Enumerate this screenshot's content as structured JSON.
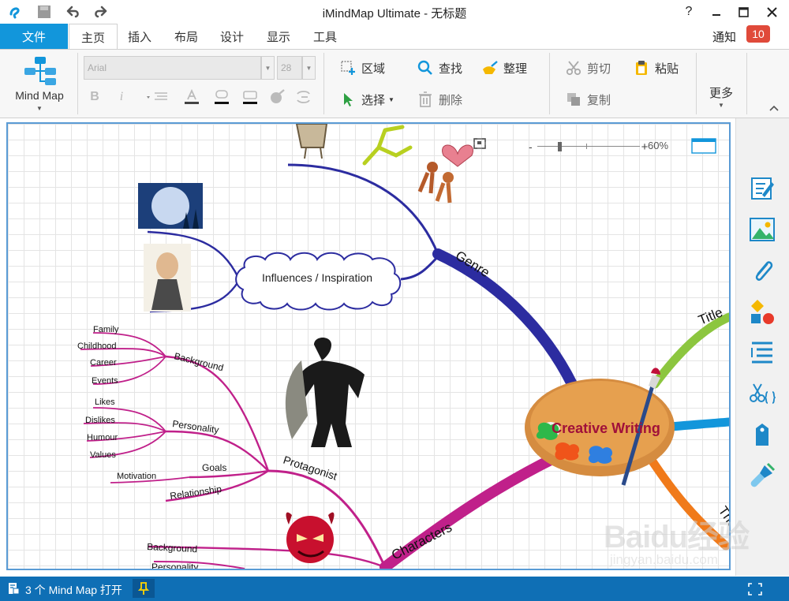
{
  "window": {
    "title": "iMindMap Ultimate - 无标题"
  },
  "quick_access": {
    "help": "?"
  },
  "tabs": {
    "file": "文件",
    "home": "主页",
    "insert": "插入",
    "layout": "布局",
    "design": "设计",
    "view": "显示",
    "tools": "工具"
  },
  "notification": {
    "label": "通知",
    "count": "10"
  },
  "ribbon": {
    "mindmap_label": "Mind Map",
    "font_name": "Arial",
    "font_size": "28",
    "area": "区域",
    "find": "查找",
    "tidy": "整理",
    "cut": "剪切",
    "paste": "粘贴",
    "select": "选择",
    "delete": "删除",
    "copy": "复制",
    "more": "更多"
  },
  "zoom": {
    "level": "60%"
  },
  "mindmap": {
    "central": "Creative Writing",
    "branches": {
      "genre": "Genre",
      "characters": "Characters",
      "title": "Title",
      "theme": "The"
    },
    "influences": "Influences / Inspiration",
    "protagonist": "Protagonist",
    "background": "Background",
    "personality": "Personality",
    "goals": "Goals",
    "relationship": "Relationship",
    "family": "Family",
    "childhood": "Childhood",
    "career": "Career",
    "events": "Events",
    "likes": "Likes",
    "dislikes": "Dislikes",
    "humour": "Humour",
    "values": "Values",
    "motivation": "Motivation",
    "villain_background": "Background",
    "villain_personality": "Personality"
  },
  "status": {
    "text": "3 个 Mind Map 打开"
  },
  "watermark": {
    "logo": "Baidu经验",
    "url": "jingyan.baidu.com"
  },
  "colors": {
    "accent": "#1296db",
    "status_bar": "#0f6fb5",
    "badge": "#e04a3a",
    "genre_branch": "#2c2ca0",
    "characters_branch": "#c0208a",
    "title_branch": "#8cc63f",
    "theme_branch": "#f07a1a",
    "central_text": "#a0103a"
  }
}
